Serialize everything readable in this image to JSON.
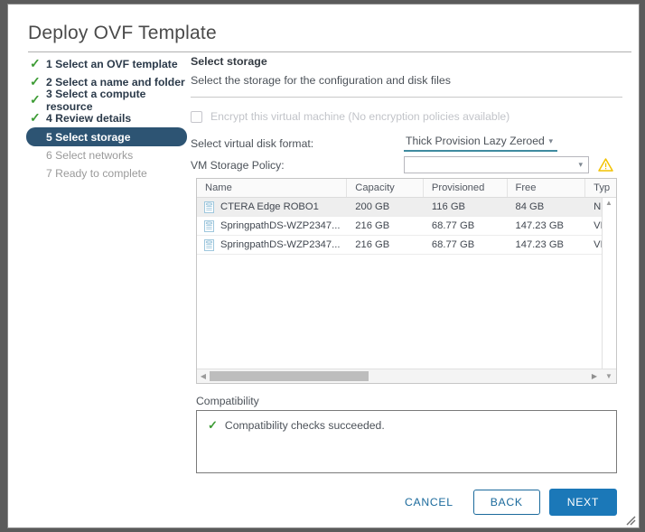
{
  "window": {
    "title": "Deploy OVF Template"
  },
  "steps": [
    {
      "label": "1 Select an OVF template",
      "state": "done"
    },
    {
      "label": "2 Select a name and folder",
      "state": "done"
    },
    {
      "label": "3 Select a compute resource",
      "state": "done"
    },
    {
      "label": "4 Review details",
      "state": "done"
    },
    {
      "label": "5 Select storage",
      "state": "current"
    },
    {
      "label": "6 Select networks",
      "state": "pending"
    },
    {
      "label": "7 Ready to complete",
      "state": "pending"
    }
  ],
  "pane": {
    "title": "Select storage",
    "subtitle": "Select the storage for the configuration and disk files"
  },
  "encrypt": {
    "label": "Encrypt this virtual machine (No encryption policies available)",
    "checked": false,
    "disabled": true
  },
  "disk_format": {
    "label": "Select virtual disk format:",
    "value": "Thick Provision Lazy Zeroed"
  },
  "storage_policy": {
    "label": "VM Storage Policy:",
    "value": "",
    "warning": true
  },
  "table": {
    "columns": [
      "Name",
      "Capacity",
      "Provisioned",
      "Free",
      "Typ"
    ],
    "rows": [
      {
        "name": "CTERA Edge ROBO1",
        "capacity": "200 GB",
        "provisioned": "116 GB",
        "free": "84 GB",
        "type": "NF",
        "selected": true
      },
      {
        "name": "SpringpathDS-WZP2347...",
        "capacity": "216 GB",
        "provisioned": "68.77 GB",
        "free": "147.23 GB",
        "type": "VM",
        "selected": false
      },
      {
        "name": "SpringpathDS-WZP2347...",
        "capacity": "216 GB",
        "provisioned": "68.77 GB",
        "free": "147.23 GB",
        "type": "VM",
        "selected": false
      }
    ]
  },
  "compatibility": {
    "label": "Compatibility",
    "message": "Compatibility checks succeeded."
  },
  "footer": {
    "cancel": "CANCEL",
    "back": "BACK",
    "next": "NEXT"
  },
  "colors": {
    "accent_blue": "#1b78b8",
    "link_blue": "#1b6a9c",
    "step_current_bg": "#2d5473",
    "success_green": "#3d9c35",
    "warning_yellow": "#f5c518",
    "underline_teal": "#3f8ba0"
  }
}
